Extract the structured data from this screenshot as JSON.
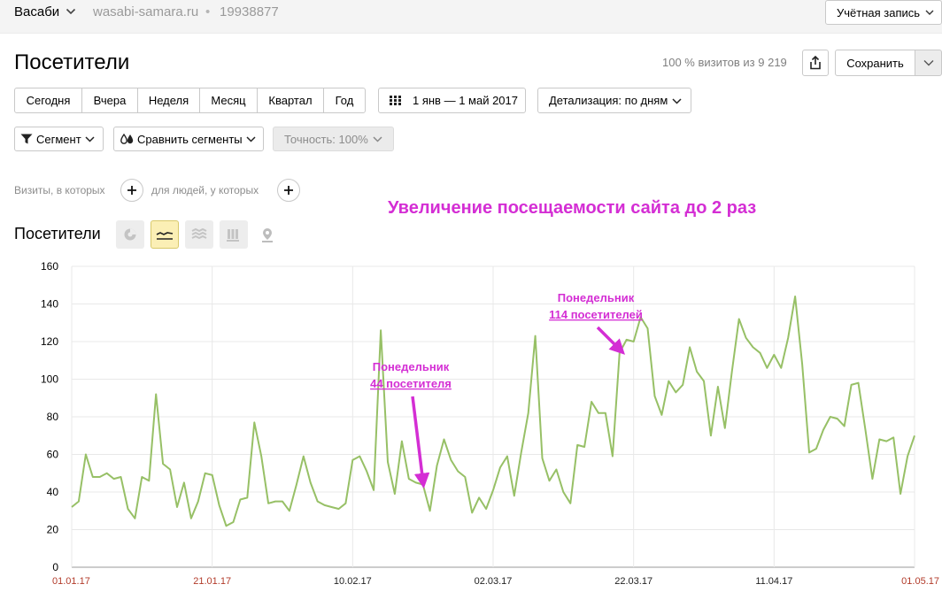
{
  "topbar": {
    "counter_name": "Васаби",
    "site_url": "wasabi-samara.ru",
    "separator": "•",
    "counter_id": "19938877",
    "account_label": "Учётная запись"
  },
  "header": {
    "title": "Посетители",
    "visits_info": "100 % визитов из 9 219",
    "save_label": "Сохранить"
  },
  "period": {
    "buttons": [
      "Сегодня",
      "Вчера",
      "Неделя",
      "Месяц",
      "Квартал",
      "Год"
    ],
    "date_range": "1 янв — 1 май 2017",
    "detail": "Детализация: по дням"
  },
  "segments": {
    "segment_label": "Сегмент",
    "compare_label": "Сравнить сегменты",
    "accuracy_label": "Точность: 100%"
  },
  "conditions": {
    "visits_label": "Визиты, в которых",
    "people_label": "для людей, у которых"
  },
  "headline": "Увеличение посещаемости сайта до 2 раз",
  "chart_section": {
    "title": "Посетители",
    "views": [
      "pie-chart-icon",
      "line-chart-icon",
      "area-chart-icon",
      "bar-chart-icon",
      "map-icon"
    ],
    "active_view": "line-chart-icon"
  },
  "colors": {
    "line": "#97c066",
    "accent": "#d42ed4",
    "weekend_tick": "#b23b2a"
  },
  "chart_data": {
    "type": "line",
    "title": "",
    "xlabel": "",
    "ylabel": "",
    "ylim": [
      0,
      160
    ],
    "yticks": [
      0,
      20,
      40,
      60,
      80,
      100,
      120,
      140,
      160
    ],
    "x_start": "01.01.17",
    "x_end": "01.05.17",
    "xtick_labels": [
      {
        "date": "01.01.17",
        "label": "01.01.17",
        "weekend": true
      },
      {
        "date": "21.01.17",
        "label": "21.01.17",
        "weekend": true
      },
      {
        "date": "10.02.17",
        "label": "10.02.17",
        "weekend": false
      },
      {
        "date": "02.03.17",
        "label": "02.03.17",
        "weekend": false
      },
      {
        "date": "22.03.17",
        "label": "22.03.17",
        "weekend": false
      },
      {
        "date": "11.04.17",
        "label": "11.04.17",
        "weekend": false
      },
      {
        "date": "01.05.17",
        "label": "01.05.17",
        "weekend": true
      }
    ],
    "grid": true,
    "series": [
      {
        "values": [
          32,
          35,
          60,
          48,
          48,
          50,
          47,
          48,
          31,
          26,
          48,
          46,
          92,
          55,
          52,
          32,
          45,
          26,
          35,
          50,
          49,
          33,
          22,
          24,
          36,
          37,
          77,
          59,
          34,
          35,
          35,
          30,
          44,
          59,
          45,
          35,
          33,
          32,
          31,
          34,
          57,
          59,
          51,
          41,
          126,
          56,
          39,
          67,
          47,
          45,
          44,
          30,
          54,
          68,
          57,
          51,
          48,
          29,
          37,
          31,
          41,
          53,
          59,
          38,
          61,
          82,
          123,
          58,
          46,
          52,
          40,
          34,
          65,
          64,
          88,
          82,
          82,
          59,
          114,
          121,
          120,
          133,
          127,
          91,
          81,
          99,
          93,
          97,
          117,
          104,
          99,
          70,
          96,
          74,
          104,
          132,
          122,
          117,
          114,
          106,
          113,
          106,
          122,
          144,
          108,
          61,
          63,
          73,
          80,
          79,
          75,
          97,
          98,
          73,
          47,
          68,
          67,
          69,
          39,
          59,
          70
        ]
      }
    ],
    "annotations": [
      {
        "line1": "Понедельник",
        "line2": "44 посетителя",
        "target_date": "20.02.17",
        "target_value": 44
      },
      {
        "line1": "Понедельник",
        "line2": "114 посетителей",
        "target_date": "20.03.17",
        "target_value": 114
      }
    ]
  }
}
